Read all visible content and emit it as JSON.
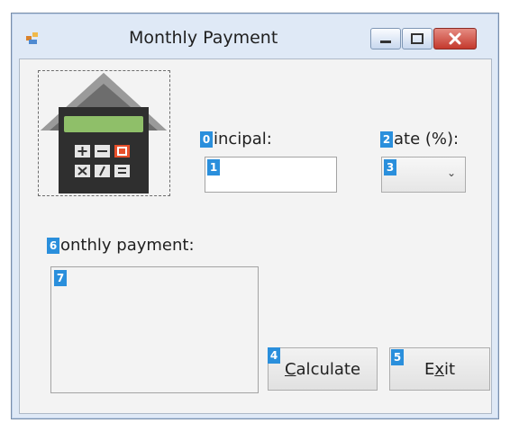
{
  "window": {
    "title": "Monthly Payment",
    "controls": {
      "minimize_icon": "minimize-icon",
      "maximize_icon": "maximize-icon",
      "close_icon": "close-icon"
    },
    "app_icon": "form-icon"
  },
  "image": {
    "icon": "house-calculator-icon"
  },
  "form": {
    "principal": {
      "badge": "0",
      "label_rest": "incipal:",
      "input_badge": "1",
      "value": ""
    },
    "rate": {
      "badge": "2",
      "label_rest": "ate (%):",
      "select_badge": "3",
      "selected": ""
    },
    "monthly": {
      "badge": "6",
      "label_rest": "onthly payment:",
      "output_badge": "7",
      "value": ""
    },
    "calculate": {
      "badge": "4",
      "mnemonic": "C",
      "label_rest": "alculate"
    },
    "exit": {
      "badge": "5",
      "label_pre": "E",
      "mnemonic": "x",
      "label_post": "it"
    }
  },
  "colors": {
    "badge": "#2a8fdc",
    "close_button": "#c4392d"
  }
}
